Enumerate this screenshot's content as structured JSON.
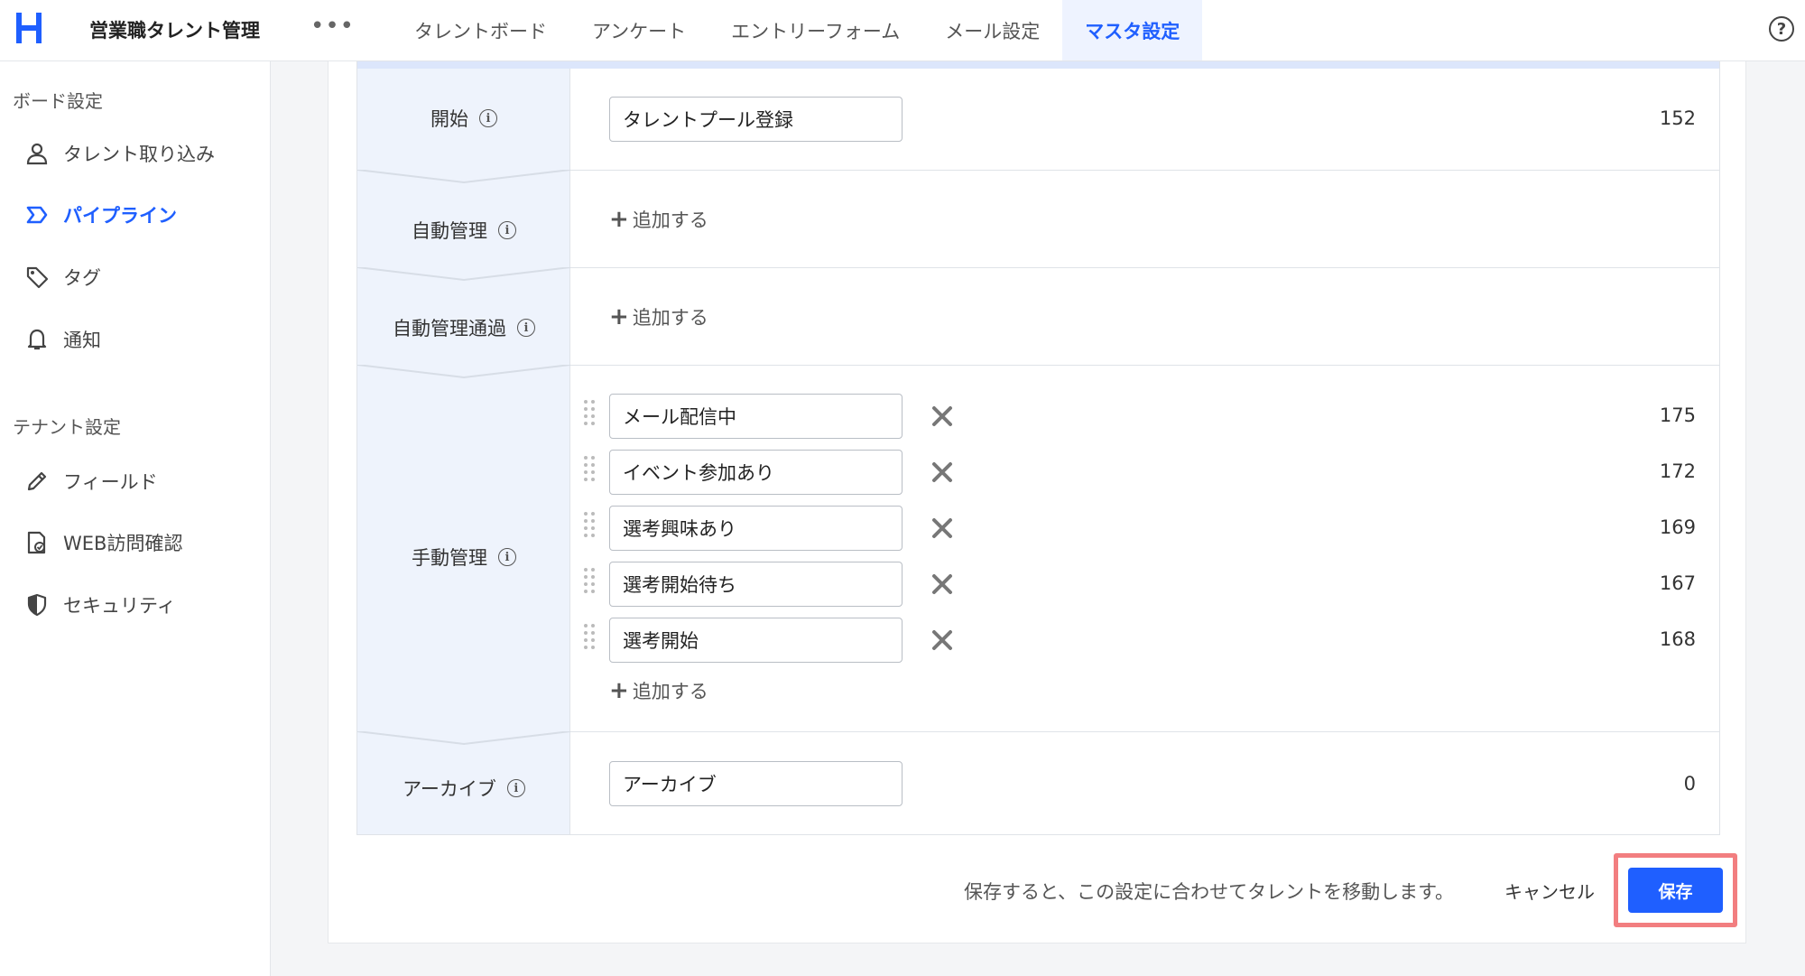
{
  "header": {
    "app_title": "営業職タレント管理",
    "more": "•••",
    "tabs": [
      {
        "label": "タレントボード"
      },
      {
        "label": "アンケート"
      },
      {
        "label": "エントリーフォーム"
      },
      {
        "label": "メール設定"
      },
      {
        "label": "マスタ設定",
        "active": true
      }
    ],
    "help": "?"
  },
  "sidebar": {
    "board_section": "ボード設定",
    "board_items": [
      {
        "label": "タレント取り込み",
        "icon": "person-icon"
      },
      {
        "label": "パイプライン",
        "icon": "pipeline-icon",
        "active": true
      },
      {
        "label": "タグ",
        "icon": "tag-icon"
      },
      {
        "label": "通知",
        "icon": "bell-icon"
      }
    ],
    "tenant_section": "テナント設定",
    "tenant_items": [
      {
        "label": "フィールド",
        "icon": "pencil-icon"
      },
      {
        "label": "WEB訪問確認",
        "icon": "web-check-icon"
      },
      {
        "label": "セキュリティ",
        "icon": "shield-icon"
      }
    ]
  },
  "pipeline": {
    "start": {
      "label": "開始",
      "value": "タレントプール登録",
      "count": "152"
    },
    "auto": {
      "label": "自動管理",
      "add": "追加する"
    },
    "auto_pass": {
      "label": "自動管理通過",
      "add": "追加する"
    },
    "manual": {
      "label": "手動管理",
      "add": "追加する",
      "stages": [
        {
          "value": "メール配信中",
          "count": "175"
        },
        {
          "value": "イベント参加あり",
          "count": "172"
        },
        {
          "value": "選考興味あり",
          "count": "169"
        },
        {
          "value": "選考開始待ち",
          "count": "167"
        },
        {
          "value": "選考開始",
          "count": "168"
        }
      ]
    },
    "archive": {
      "label": "アーカイブ",
      "value": "アーカイブ",
      "count": "0"
    }
  },
  "footer": {
    "message": "保存すると、この設定に合わせてタレントを移動します。",
    "cancel": "キャンセル",
    "save": "保存"
  },
  "colors": {
    "accent": "#1f5fff",
    "highlight": "#f27e80"
  }
}
